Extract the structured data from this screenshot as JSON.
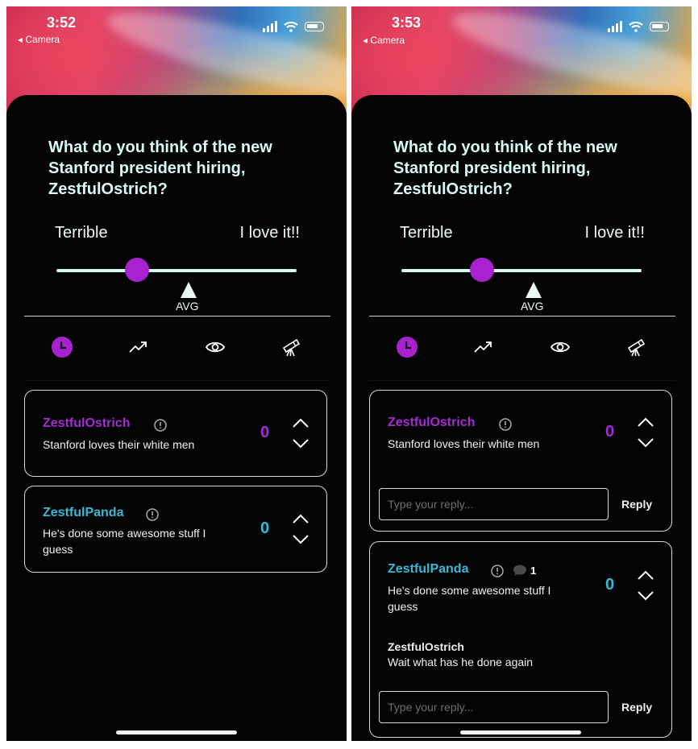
{
  "left": {
    "status": {
      "time": "3:52",
      "back": "◂ Camera"
    },
    "question": "What do you think of the new Stanford president hiring, ZestfulOstrich?",
    "scale": {
      "low": "Terrible",
      "high": "I love it!!",
      "avg": "AVG",
      "value": 0.33
    },
    "tabs": [
      "clock-icon",
      "trending-icon",
      "eye-icon",
      "telescope-icon"
    ],
    "comments": [
      {
        "user": "ZestfulOstrich",
        "text": "Stanford loves their white men",
        "score": "0",
        "color": "#a52bd4"
      },
      {
        "user": "ZestfulPanda",
        "text": "He's done some awesome stuff I guess",
        "score": "0",
        "color": "#38b9d6"
      }
    ]
  },
  "right": {
    "status": {
      "time": "3:53",
      "back": "◂ Camera"
    },
    "question": "What do you think of the new Stanford president hiring, ZestfulOstrich?",
    "scale": {
      "low": "Terrible",
      "high": "I love it!!",
      "avg": "AVG",
      "value": 0.33
    },
    "tabs": [
      "clock-icon",
      "trending-icon",
      "eye-icon",
      "telescope-icon"
    ],
    "comments": [
      {
        "user": "ZestfulOstrich",
        "text": "Stanford loves their white men",
        "score": "0",
        "reply_placeholder": "Type your reply...",
        "reply_label": "Reply"
      },
      {
        "user": "ZestfulPanda",
        "text": "He's done some awesome stuff I guess",
        "score": "0",
        "reply_count": "1",
        "replies": [
          {
            "user": "ZestfulOstrich",
            "text": "Wait what has he done again"
          }
        ],
        "reply_placeholder": "Type your reply...",
        "reply_label": "Reply"
      }
    ]
  }
}
